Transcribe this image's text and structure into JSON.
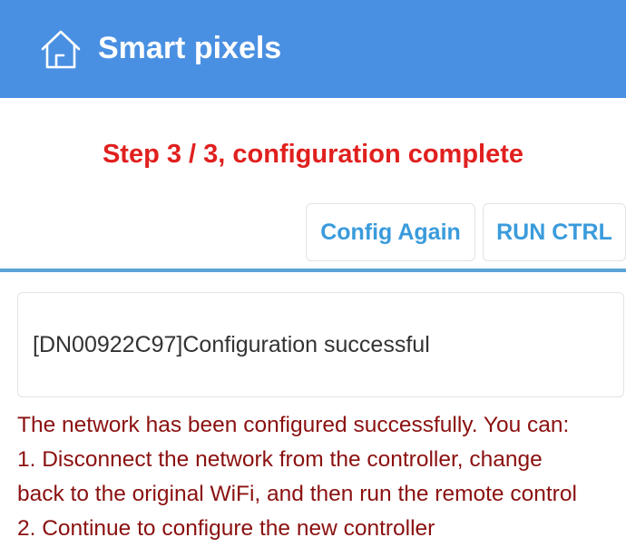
{
  "header": {
    "icon": "home-icon",
    "title": "Smart pixels",
    "background_color": "#4a90e2"
  },
  "step": {
    "title": "Step 3 / 3, configuration complete",
    "color": "#e0201e"
  },
  "actions": {
    "config_again_label": "Config Again",
    "run_ctrl_label": "RUN CTRL"
  },
  "result": {
    "message": "[DN00922C97]Configuration successful"
  },
  "instructions": {
    "lines": [
      "The network has been configured successfully. You can:",
      "1. Disconnect the network from the controller, change",
      "back to the original WiFi, and then run the remote control",
      "2. Continue to configure the new controller"
    ]
  }
}
